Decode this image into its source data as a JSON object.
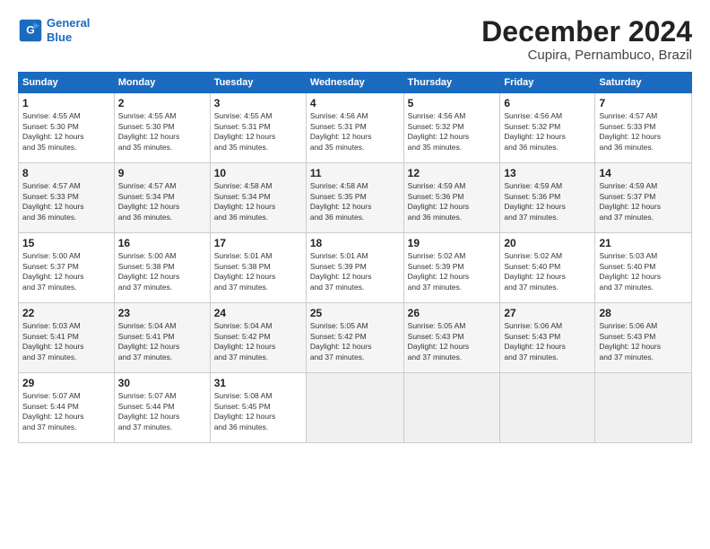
{
  "logo": {
    "line1": "General",
    "line2": "Blue"
  },
  "title": "December 2024",
  "location": "Cupira, Pernambuco, Brazil",
  "header_days": [
    "Sunday",
    "Monday",
    "Tuesday",
    "Wednesday",
    "Thursday",
    "Friday",
    "Saturday"
  ],
  "weeks": [
    [
      {
        "day": "1",
        "info": "Sunrise: 4:55 AM\nSunset: 5:30 PM\nDaylight: 12 hours\nand 35 minutes."
      },
      {
        "day": "2",
        "info": "Sunrise: 4:55 AM\nSunset: 5:30 PM\nDaylight: 12 hours\nand 35 minutes."
      },
      {
        "day": "3",
        "info": "Sunrise: 4:55 AM\nSunset: 5:31 PM\nDaylight: 12 hours\nand 35 minutes."
      },
      {
        "day": "4",
        "info": "Sunrise: 4:56 AM\nSunset: 5:31 PM\nDaylight: 12 hours\nand 35 minutes."
      },
      {
        "day": "5",
        "info": "Sunrise: 4:56 AM\nSunset: 5:32 PM\nDaylight: 12 hours\nand 35 minutes."
      },
      {
        "day": "6",
        "info": "Sunrise: 4:56 AM\nSunset: 5:32 PM\nDaylight: 12 hours\nand 36 minutes."
      },
      {
        "day": "7",
        "info": "Sunrise: 4:57 AM\nSunset: 5:33 PM\nDaylight: 12 hours\nand 36 minutes."
      }
    ],
    [
      {
        "day": "8",
        "info": "Sunrise: 4:57 AM\nSunset: 5:33 PM\nDaylight: 12 hours\nand 36 minutes."
      },
      {
        "day": "9",
        "info": "Sunrise: 4:57 AM\nSunset: 5:34 PM\nDaylight: 12 hours\nand 36 minutes."
      },
      {
        "day": "10",
        "info": "Sunrise: 4:58 AM\nSunset: 5:34 PM\nDaylight: 12 hours\nand 36 minutes."
      },
      {
        "day": "11",
        "info": "Sunrise: 4:58 AM\nSunset: 5:35 PM\nDaylight: 12 hours\nand 36 minutes."
      },
      {
        "day": "12",
        "info": "Sunrise: 4:59 AM\nSunset: 5:36 PM\nDaylight: 12 hours\nand 36 minutes."
      },
      {
        "day": "13",
        "info": "Sunrise: 4:59 AM\nSunset: 5:36 PM\nDaylight: 12 hours\nand 37 minutes."
      },
      {
        "day": "14",
        "info": "Sunrise: 4:59 AM\nSunset: 5:37 PM\nDaylight: 12 hours\nand 37 minutes."
      }
    ],
    [
      {
        "day": "15",
        "info": "Sunrise: 5:00 AM\nSunset: 5:37 PM\nDaylight: 12 hours\nand 37 minutes."
      },
      {
        "day": "16",
        "info": "Sunrise: 5:00 AM\nSunset: 5:38 PM\nDaylight: 12 hours\nand 37 minutes."
      },
      {
        "day": "17",
        "info": "Sunrise: 5:01 AM\nSunset: 5:38 PM\nDaylight: 12 hours\nand 37 minutes."
      },
      {
        "day": "18",
        "info": "Sunrise: 5:01 AM\nSunset: 5:39 PM\nDaylight: 12 hours\nand 37 minutes."
      },
      {
        "day": "19",
        "info": "Sunrise: 5:02 AM\nSunset: 5:39 PM\nDaylight: 12 hours\nand 37 minutes."
      },
      {
        "day": "20",
        "info": "Sunrise: 5:02 AM\nSunset: 5:40 PM\nDaylight: 12 hours\nand 37 minutes."
      },
      {
        "day": "21",
        "info": "Sunrise: 5:03 AM\nSunset: 5:40 PM\nDaylight: 12 hours\nand 37 minutes."
      }
    ],
    [
      {
        "day": "22",
        "info": "Sunrise: 5:03 AM\nSunset: 5:41 PM\nDaylight: 12 hours\nand 37 minutes."
      },
      {
        "day": "23",
        "info": "Sunrise: 5:04 AM\nSunset: 5:41 PM\nDaylight: 12 hours\nand 37 minutes."
      },
      {
        "day": "24",
        "info": "Sunrise: 5:04 AM\nSunset: 5:42 PM\nDaylight: 12 hours\nand 37 minutes."
      },
      {
        "day": "25",
        "info": "Sunrise: 5:05 AM\nSunset: 5:42 PM\nDaylight: 12 hours\nand 37 minutes."
      },
      {
        "day": "26",
        "info": "Sunrise: 5:05 AM\nSunset: 5:43 PM\nDaylight: 12 hours\nand 37 minutes."
      },
      {
        "day": "27",
        "info": "Sunrise: 5:06 AM\nSunset: 5:43 PM\nDaylight: 12 hours\nand 37 minutes."
      },
      {
        "day": "28",
        "info": "Sunrise: 5:06 AM\nSunset: 5:43 PM\nDaylight: 12 hours\nand 37 minutes."
      }
    ],
    [
      {
        "day": "29",
        "info": "Sunrise: 5:07 AM\nSunset: 5:44 PM\nDaylight: 12 hours\nand 37 minutes."
      },
      {
        "day": "30",
        "info": "Sunrise: 5:07 AM\nSunset: 5:44 PM\nDaylight: 12 hours\nand 37 minutes."
      },
      {
        "day": "31",
        "info": "Sunrise: 5:08 AM\nSunset: 5:45 PM\nDaylight: 12 hours\nand 36 minutes."
      },
      null,
      null,
      null,
      null
    ]
  ]
}
